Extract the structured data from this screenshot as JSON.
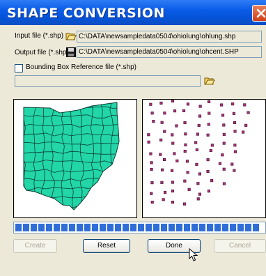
{
  "window": {
    "title": "SHAPE CONVERSION"
  },
  "input": {
    "label": "Input file (*.shp)",
    "path": "C:\\DATA\\newsampledata0504\\ohiolung\\ohlung.shp",
    "icon": "open-folder-icon"
  },
  "output": {
    "label": "Output file (*.shp)",
    "path": "C:\\DATA\\newsampledata0504\\ohiolung\\ohcent.SHP",
    "icon": "save-disk-icon"
  },
  "bbox": {
    "label": "Bounding Box Reference  file (*.shp)",
    "checked": false,
    "path": "",
    "icon": "open-folder-icon"
  },
  "preview": {
    "left": "ohio-county-polygons",
    "right": "county-centroid-points"
  },
  "progress": {
    "percent": 100,
    "color": "#2F6ED6"
  },
  "buttons": {
    "create": "Create",
    "reset": "Reset",
    "done": "Done",
    "cancel": "Cancel"
  }
}
